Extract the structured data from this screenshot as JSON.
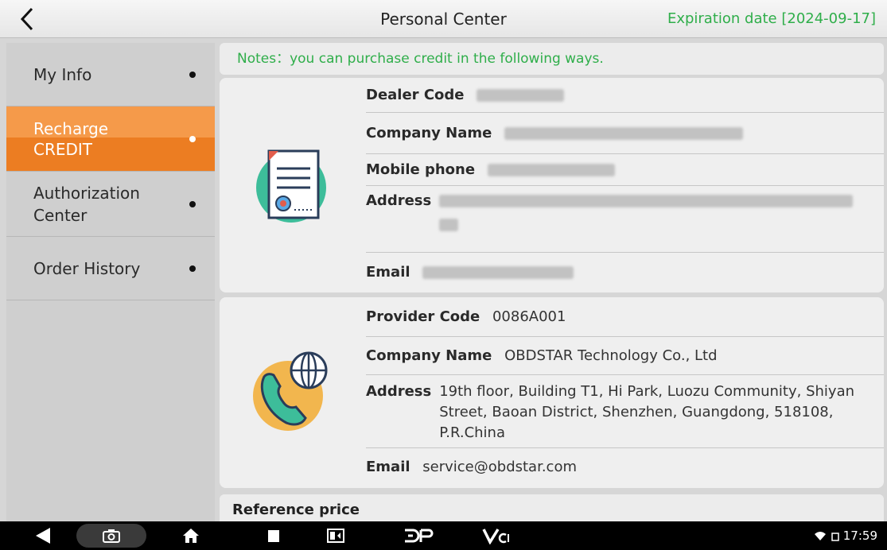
{
  "header": {
    "title": "Personal Center",
    "expiration": "Expiration date [2024-09-17]"
  },
  "sidebar": {
    "items": [
      {
        "label": "My Info"
      },
      {
        "label": "Recharge\nCREDIT"
      },
      {
        "label": "Authorization\nCenter"
      },
      {
        "label": "Order History"
      }
    ]
  },
  "notes": "Notes：you can purchase credit in the following ways.",
  "dealer": {
    "dealer_code_label": "Dealer Code",
    "company_name_label": "Company Name",
    "mobile_label": "Mobile phone",
    "address_label": "Address",
    "email_label": "Email"
  },
  "provider": {
    "code_label": "Provider Code",
    "code_value": "0086A001",
    "company_label": "Company Name",
    "company_value": "OBDSTAR Technology Co., Ltd",
    "address_label": "Address",
    "address_value": "19th floor, Building T1, Hi Park, Luozu Community, Shiyan Street, Baoan District, Shenzhen, Guangdong, 518108, P.R.China",
    "email_label": "Email",
    "email_value": "service@obdstar.com"
  },
  "reference_price": "Reference price",
  "status": {
    "time": "17:59"
  },
  "colors": {
    "accent_orange": "#ec7d22",
    "notes_green": "#2fae4a"
  }
}
